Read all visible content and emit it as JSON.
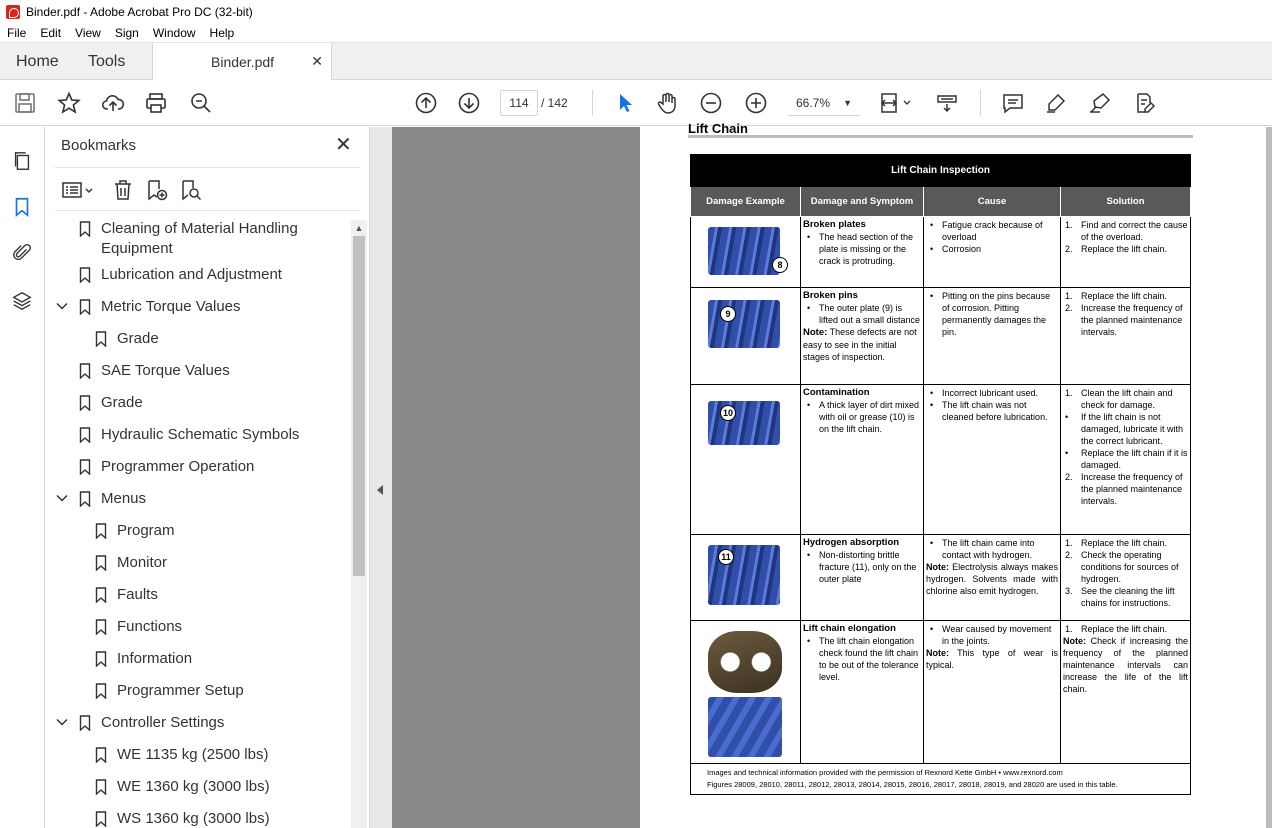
{
  "window": {
    "title": "Binder.pdf - Adobe Acrobat Pro DC (32-bit)"
  },
  "menubar": [
    "File",
    "Edit",
    "View",
    "Sign",
    "Window",
    "Help"
  ],
  "tabs": {
    "home": "Home",
    "tools": "Tools",
    "document": "Binder.pdf"
  },
  "toolbar": {
    "current_page": "114",
    "total_pages": "/ 142",
    "zoom": "66.7%"
  },
  "bookmarks": {
    "title": "Bookmarks",
    "items": [
      {
        "label": "Cleaning of Material Handling Equipment",
        "level": 0,
        "expandable": false
      },
      {
        "label": "Lubrication and Adjustment",
        "level": 0,
        "expandable": false
      },
      {
        "label": "Metric Torque Values",
        "level": 0,
        "expandable": true
      },
      {
        "label": "Grade",
        "level": 1,
        "expandable": false
      },
      {
        "label": "SAE Torque Values",
        "level": 0,
        "expandable": false
      },
      {
        "label": "Grade",
        "level": 0,
        "expandable": false
      },
      {
        "label": "Hydraulic Schematic Symbols",
        "level": 0,
        "expandable": false
      },
      {
        "label": "Programmer Operation",
        "level": 0,
        "expandable": false
      },
      {
        "label": "Menus",
        "level": 0,
        "expandable": true
      },
      {
        "label": "Program",
        "level": 1,
        "expandable": false
      },
      {
        "label": "Monitor",
        "level": 1,
        "expandable": false
      },
      {
        "label": "Faults",
        "level": 1,
        "expandable": false
      },
      {
        "label": "Functions",
        "level": 1,
        "expandable": false
      },
      {
        "label": "Information",
        "level": 1,
        "expandable": false
      },
      {
        "label": "Programmer Setup",
        "level": 1,
        "expandable": false
      },
      {
        "label": "Controller Settings",
        "level": 0,
        "expandable": true
      },
      {
        "label": "WE 1135 kg (2500 lbs)",
        "level": 1,
        "expandable": false
      },
      {
        "label": "WE 1360 kg (3000 lbs)",
        "level": 1,
        "expandable": false
      },
      {
        "label": "WS 1360 kg (3000 lbs)",
        "level": 1,
        "expandable": false
      }
    ]
  },
  "document": {
    "section_title": "Lift Chain",
    "table_title": "Lift Chain Inspection",
    "headers": [
      "Damage Example",
      "Damage and Symptom",
      "Cause",
      "Solution"
    ],
    "rows": [
      {
        "callout": "8",
        "damage_title": "Broken plates",
        "damage_bullets": [
          "The head section of the plate is missing or the crack is protruding."
        ],
        "damage_note": "",
        "cause_bullets": [
          "Fatigue crack because of overload",
          "Corrosion"
        ],
        "cause_note": "",
        "solution_items": [
          {
            "n": "1.",
            "t": "Find and correct the cause of the overload."
          },
          {
            "n": "2.",
            "t": "Replace the lift chain."
          }
        ],
        "solution_note": ""
      },
      {
        "callout": "9",
        "damage_title": "Broken pins",
        "damage_bullets": [
          "The outer plate (9) is lifted out a small distance"
        ],
        "damage_note": "These defects are not easy to see in the initial stages of inspection.",
        "cause_bullets": [
          "Pitting on the pins because of corrosion. Pitting permanently damages the pin."
        ],
        "cause_note": "",
        "solution_items": [
          {
            "n": "1.",
            "t": "Replace the lift chain."
          },
          {
            "n": "2.",
            "t": "Increase the frequency of the planned maintenance intervals."
          }
        ],
        "solution_note": ""
      },
      {
        "callout": "10",
        "damage_title": "Contamination",
        "damage_bullets": [
          "A thick layer of dirt mixed with oil or grease (10) is on the lift chain."
        ],
        "damage_note": "",
        "cause_bullets": [
          "Incorrect lubricant used.",
          "The lift chain was not cleaned before lubrication."
        ],
        "cause_note": "",
        "solution_items": [
          {
            "n": "1.",
            "t": "Clean the lift chain and check for damage."
          },
          {
            "n": "•",
            "t": "If the lift chain is not damaged, lubricate it with the correct lubricant."
          },
          {
            "n": "•",
            "t": "Replace the lift chain if it is damaged."
          },
          {
            "n": "2.",
            "t": "Increase the frequency of the planned maintenance intervals."
          }
        ],
        "solution_note": ""
      },
      {
        "callout": "11",
        "damage_title": "Hydrogen absorption",
        "damage_bullets": [
          "Non-distorting brittle fracture (11), only on the outer plate"
        ],
        "damage_note": "",
        "cause_bullets": [
          "The lift chain came into contact with hydrogen."
        ],
        "cause_note": "Electrolysis always makes hydrogen. Solvents made with chlorine also emit hydrogen.",
        "solution_items": [
          {
            "n": "1.",
            "t": "Replace the lift chain."
          },
          {
            "n": "2.",
            "t": "Check the operating conditions for sources of hydrogen."
          },
          {
            "n": "3.",
            "t": "See the cleaning the lift chains for instructions."
          }
        ],
        "solution_note": ""
      },
      {
        "callout": "",
        "damage_title": "Lift chain elongation",
        "damage_bullets": [
          "The lift chain elongation check found the lift chain to be out of the tolerance level."
        ],
        "damage_note": "",
        "cause_bullets": [
          "Wear caused by movement in the joints."
        ],
        "cause_note": "This type of wear is typical.",
        "solution_items": [
          {
            "n": "1.",
            "t": "Replace the lift chain."
          }
        ],
        "solution_note": "Check if increasing the frequency of the planned maintenance intervals can increase the life of the lift chain."
      }
    ],
    "note_label": "Note:",
    "footer_lines": [
      "Images and technical information provided with the permission of Rexnord Kette GmbH • www.rexnord.com",
      "Figures 28009, 28010, 28011, 28012, 28013, 28014, 28015, 28016, 28017, 28018, 28019, and 28020 are used in this table."
    ]
  },
  "colors": {
    "accent_blue": "#1473e6",
    "chain_blue": "#2f4fa8",
    "table_header": "#000000",
    "subheader": "#595959"
  }
}
